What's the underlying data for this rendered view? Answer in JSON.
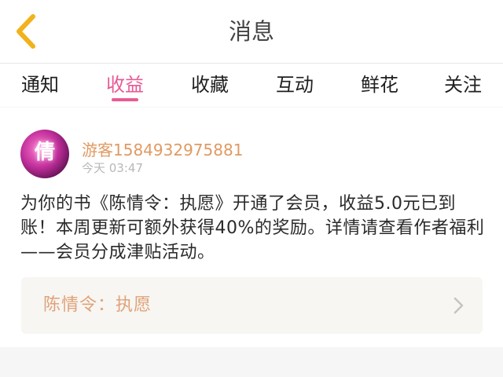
{
  "header": {
    "title": "消息",
    "back_icon": "chevron-left-icon",
    "accent_color": "#f2b21c"
  },
  "tabs": [
    {
      "label": "通知"
    },
    {
      "label": "收益",
      "active": true
    },
    {
      "label": "收藏"
    },
    {
      "label": "互动"
    },
    {
      "label": "鲜花"
    },
    {
      "label": "关注"
    }
  ],
  "message": {
    "avatar_glyph": "倩",
    "username": "游客1584932975881",
    "time": "今天 03:47",
    "body": "为你的书《陈情令：执愿》开通了会员，收益5.0元已到账！本周更新可额外获得40%的奖励。详情请查看作者福利——会员分成津贴活动。",
    "book_title": "陈情令：执愿",
    "card_icon": "chevron-right-icon"
  },
  "colors": {
    "active_tab": "#e85a95",
    "username": "#e09a62",
    "book_title": "#e0a27a"
  }
}
